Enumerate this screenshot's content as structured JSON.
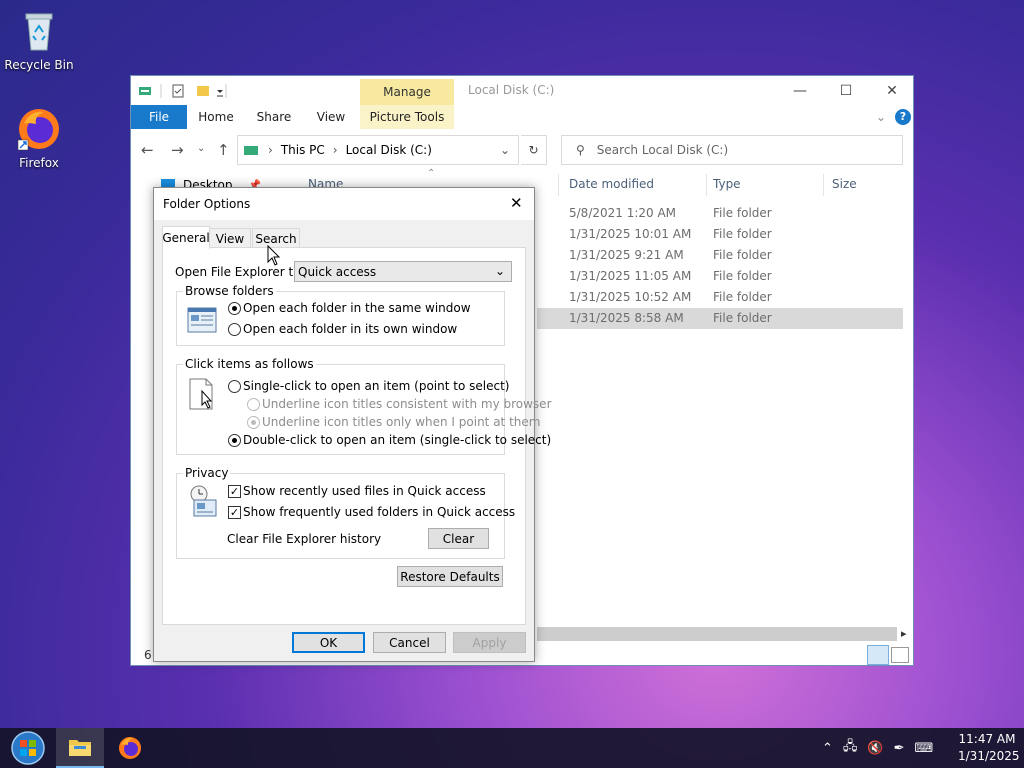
{
  "desktop": {
    "icons": [
      {
        "label": "Recycle Bin",
        "icon": "recycle-bin-icon"
      },
      {
        "label": "Firefox",
        "icon": "firefox-icon"
      }
    ]
  },
  "explorer": {
    "title": "Local Disk (C:)",
    "manage_tab": "Manage",
    "picture_tools_tab": "Picture Tools",
    "ribbon_tabs": [
      "File",
      "Home",
      "Share",
      "View"
    ],
    "address": {
      "root": "This PC",
      "current": "Local Disk (C:)"
    },
    "search_placeholder": "Search Local Disk (C:)",
    "nav_pane_item": "Desktop",
    "columns": [
      "Name",
      "Date modified",
      "Type",
      "Size"
    ],
    "rows": [
      {
        "date": "5/8/2021 1:20 AM",
        "type": "File folder"
      },
      {
        "date": "1/31/2025 10:01 AM",
        "type": "File folder"
      },
      {
        "date": "1/31/2025 9:21 AM",
        "type": "File folder"
      },
      {
        "date": "1/31/2025 11:05 AM",
        "type": "File folder"
      },
      {
        "date": "1/31/2025 10:52 AM",
        "type": "File folder"
      },
      {
        "date": "1/31/2025 8:58 AM",
        "type": "File folder"
      }
    ],
    "status_count": "6"
  },
  "dialog": {
    "title": "Folder Options",
    "tabs": [
      "General",
      "View",
      "Search"
    ],
    "open_label": "Open File Explorer to:",
    "open_value": "Quick access",
    "browse": {
      "label": "Browse folders",
      "opt1": "Open each folder in the same window",
      "opt2": "Open each folder in its own window"
    },
    "click": {
      "label": "Click items as follows",
      "opt1": "Single-click to open an item (point to select)",
      "sub1": "Underline icon titles consistent with my browser",
      "sub2": "Underline icon titles only when I point at them",
      "opt2": "Double-click to open an item (single-click to select)"
    },
    "privacy": {
      "label": "Privacy",
      "chk1": "Show recently used files in Quick access",
      "chk2": "Show frequently used folders in Quick access",
      "clear_label": "Clear File Explorer history",
      "clear_btn": "Clear"
    },
    "restore_btn": "Restore Defaults",
    "ok_btn": "OK",
    "cancel_btn": "Cancel",
    "apply_btn": "Apply"
  },
  "taskbar": {
    "time": "11:47 AM",
    "date": "1/31/2025"
  }
}
